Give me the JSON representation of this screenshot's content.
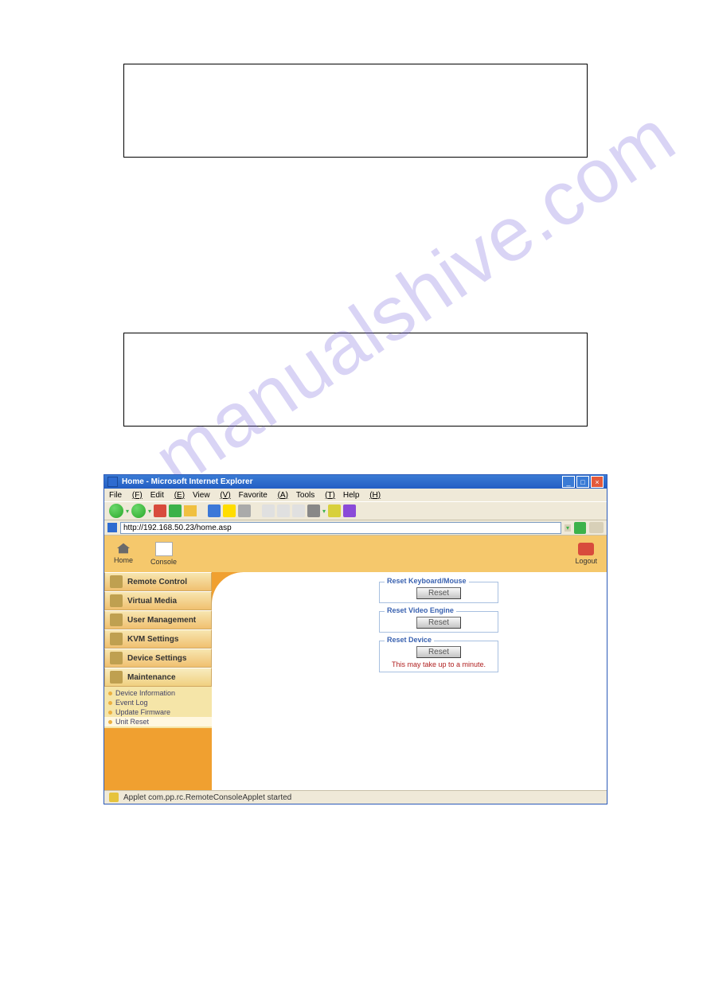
{
  "watermark": "manualshive.com",
  "window": {
    "title": "Home - Microsoft Internet Explorer",
    "btn_min": "_",
    "btn_max": "□",
    "btn_close": "×"
  },
  "menu": {
    "file": "File",
    "edit": "Edit",
    "view": "View",
    "favorites": "Favorite",
    "tools": "Tools",
    "help": "Help"
  },
  "address": {
    "url": "http://192.168.50.23/home.asp"
  },
  "topbar": {
    "home": "Home",
    "console": "Console",
    "logout": "Logout"
  },
  "nav": {
    "remote": "Remote Control",
    "vmedia": "Virtual Media",
    "usermgmt": "User Management",
    "kvm": "KVM Settings",
    "devset": "Device Settings",
    "maint": "Maintenance",
    "sub": {
      "devinfo": "Device Information",
      "eventlog": "Event Log",
      "updfw": "Update Firmware",
      "unitreset": "Unit Reset"
    }
  },
  "panels": {
    "kbm": {
      "legend": "Reset Keyboard/Mouse",
      "btn": "Reset"
    },
    "video": {
      "legend": "Reset Video Engine",
      "btn": "Reset"
    },
    "device": {
      "legend": "Reset Device",
      "btn": "Reset",
      "warn": "This may take up to a minute."
    }
  },
  "status": {
    "text": "Applet com.pp.rc.RemoteConsoleApplet started"
  }
}
